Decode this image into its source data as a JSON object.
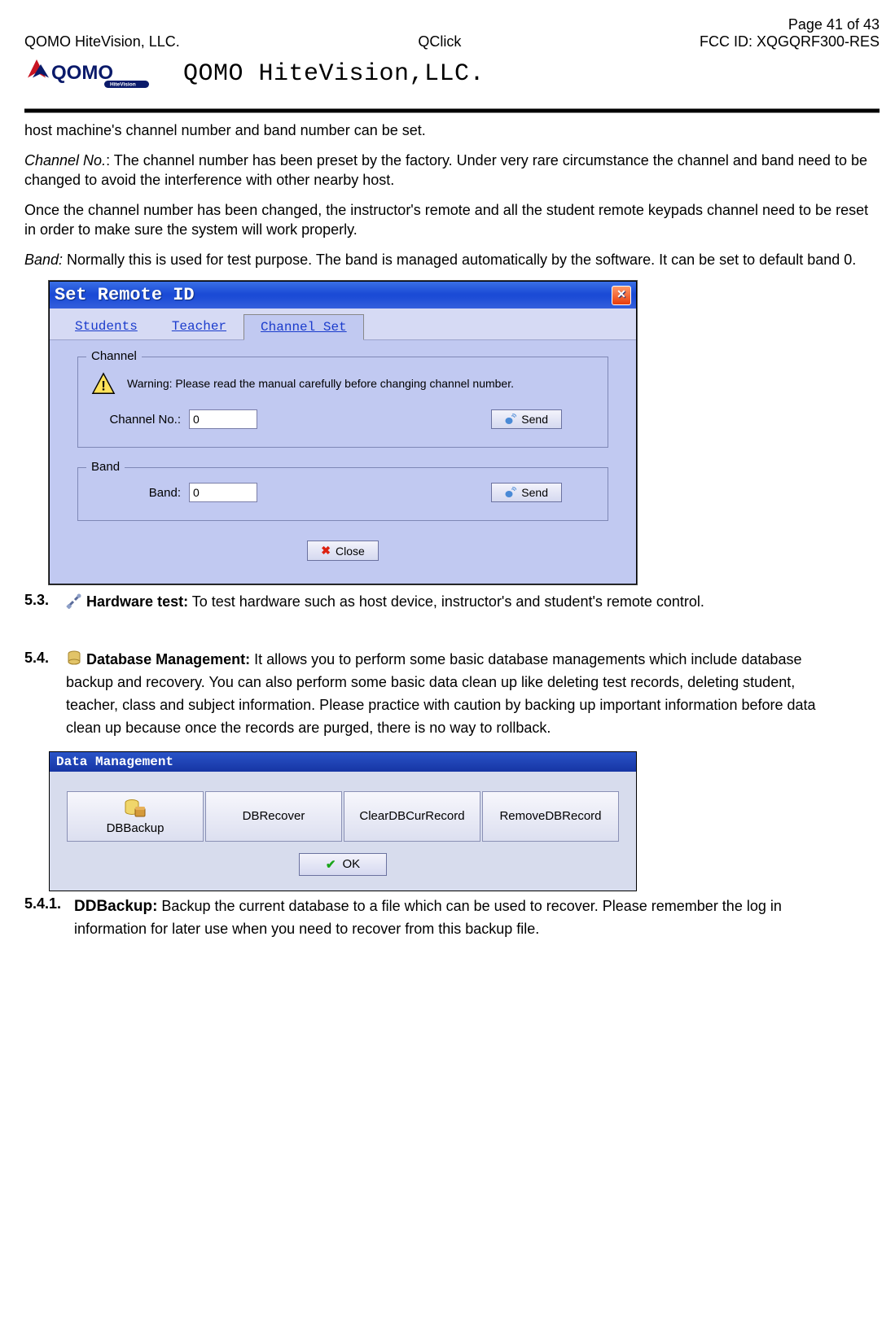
{
  "header": {
    "page_info": "Page 41 of 43",
    "left": "QOMO HiteVision, LLC.",
    "center": "QClick",
    "right": "FCC ID: XQGQRF300-RES",
    "company_title": "QOMO HiteVision,LLC."
  },
  "paragraphs": {
    "p1": "host machine's channel number and band number can be set.",
    "p2a": "Channel No.",
    "p2b": ": The channel number has been preset by the factory. Under very rare circumstance the channel and band need to be changed to avoid the interference with other nearby host.",
    "p3": "Once the channel number has been changed, the instructor's remote and all the student remote keypads channel need to be reset in order to make sure the system will work properly.",
    "p4a": "Band:",
    "p4b": " Normally this is used for test purpose. The band is managed automatically by the software. It can be set to default band 0."
  },
  "win1": {
    "title": "Set Remote ID",
    "tabs": [
      "Students",
      "Teacher",
      "Channel Set"
    ],
    "group_channel_label": "Channel",
    "warning": "Warning: Please read the manual carefully before changing channel number.",
    "channel_label": "Channel No.:",
    "channel_value": "0",
    "send": "Send",
    "group_band_label": "Band",
    "band_label": "Band:",
    "band_value": "0",
    "close": "Close"
  },
  "sec53": {
    "num": "5.3.",
    "title": "Hardware test:",
    "body": " To test hardware such as host device, instructor's and student's remote control."
  },
  "sec54": {
    "num": "5.4.",
    "title": "Database Management:",
    "body": " It allows you to perform some basic database managements which include database backup and recovery. You can also perform some basic data clean up like deleting test records, deleting student, teacher, class and subject information. Please practice with caution by backing up important information before data clean up because once the records are purged, there is no way to rollback."
  },
  "win2": {
    "title": "Data Management",
    "buttons": [
      "DBBackup",
      "DBRecover",
      "ClearDBCurRecord",
      "RemoveDBRecord"
    ],
    "ok": "OK"
  },
  "sec541": {
    "num": "5.4.1.",
    "title": "DDBackup:",
    "body": " Backup the current database to a file which can be used to recover. Please remember the log in information for later use when you need to recover from this backup file."
  }
}
